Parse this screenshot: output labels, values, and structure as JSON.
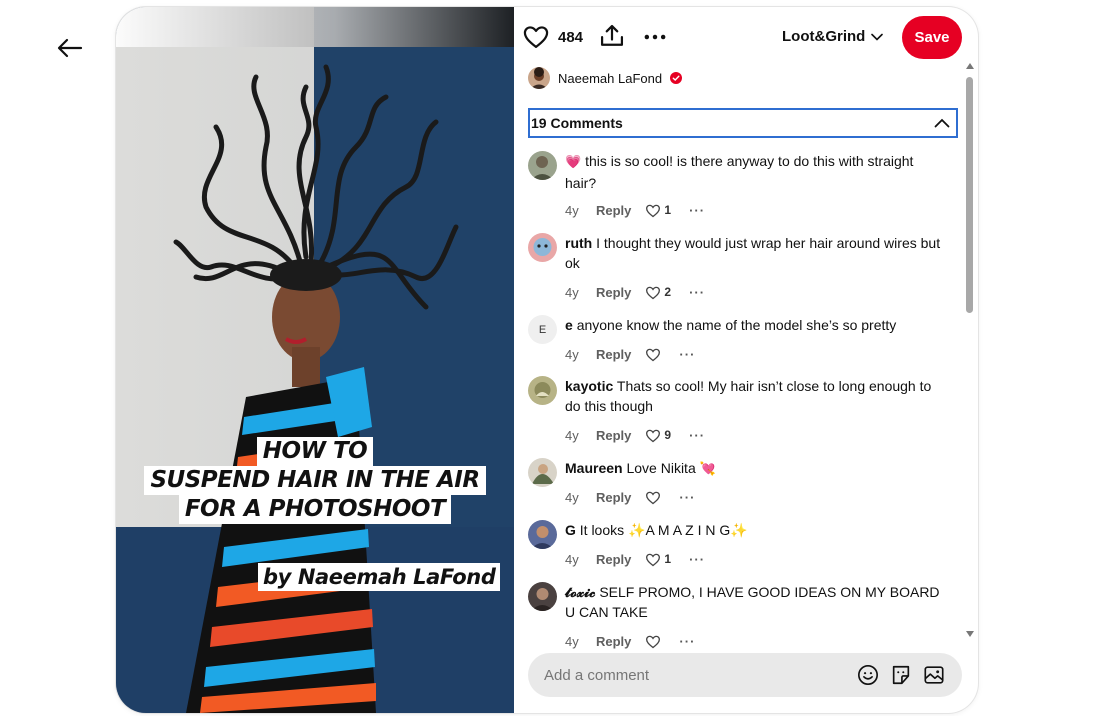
{
  "pin": {
    "overlay_lines": [
      "HOW TO",
      "SUSPEND HAIR IN THE AIR",
      "FOR A PHOTOSHOOT"
    ],
    "overlay_byline": "by Naeemah LaFond"
  },
  "toolbar": {
    "like_icon": "heart-outline-icon",
    "like_count": "484",
    "share_icon": "share-upload-icon",
    "more_icon": "more-dots-icon",
    "board_name": "Loot&Grind",
    "save_label": "Save",
    "save_color": "#e60023"
  },
  "author": {
    "name": "Naeemah LaFond",
    "verified_color": "#e60023"
  },
  "comments_section": {
    "title": "19 Comments",
    "collapse_icon": "chevron-up-icon",
    "reply_label": "Reply",
    "comments": [
      {
        "user": "",
        "text": "this is so cool! is there anyway to do this with straight hair?",
        "emoji": "💗",
        "age": "4y",
        "likes": "1"
      },
      {
        "user": "ruth",
        "text": "I thought they would just wrap her hair around wires but ok",
        "age": "4y",
        "likes": "2"
      },
      {
        "user": "e",
        "avatar_letter": "E",
        "text": "anyone know the name of the model she’s so pretty",
        "age": "4y",
        "likes": ""
      },
      {
        "user": "kayotic",
        "text": "Thats so cool! My hair isn’t close to long enough to do this though",
        "age": "4y",
        "likes": "9"
      },
      {
        "user": "Maureen",
        "text": "Love Nikita",
        "emoji": "💘",
        "age": "4y",
        "likes": ""
      },
      {
        "user": "G",
        "text": "It looks ✨A M A Z I N G✨",
        "age": "4y",
        "likes": "1"
      },
      {
        "user": "𝓽𝓸𝔁𝓲𝓬",
        "text": "SELF PROMO, I HAVE GOOD IDEAS ON MY BOARD U CAN TAKE",
        "age": "4y",
        "likes": ""
      }
    ]
  },
  "composer": {
    "placeholder": "Add a comment",
    "icons": [
      "emoji-icon",
      "sticker-icon",
      "image-icon"
    ]
  }
}
